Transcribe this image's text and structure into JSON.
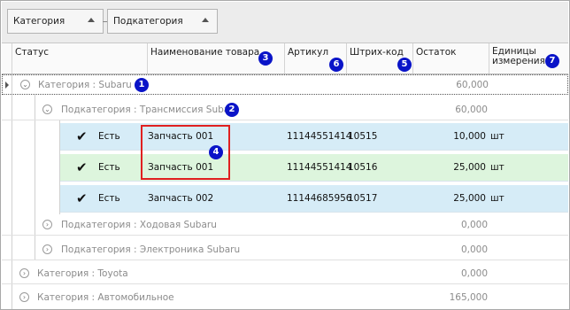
{
  "group_bar": {
    "buttons": [
      {
        "label": "Категория"
      },
      {
        "label": "Подкатегория"
      }
    ]
  },
  "columns": [
    {
      "label": "Статус",
      "badge": ""
    },
    {
      "label": "Наименование товара",
      "badge": "3"
    },
    {
      "label": "Артикул",
      "badge": "6"
    },
    {
      "label": "Штрих-код",
      "badge": "5"
    },
    {
      "label": "Остаток",
      "badge": ""
    },
    {
      "label": "Единицы измерения",
      "badge": "7"
    }
  ],
  "groups": [
    {
      "text": "Категория : Subaru",
      "badge": "1",
      "total": "60,000"
    },
    {
      "text": "Подкатегория : Трансмиссия Subaru",
      "badge": "2",
      "total": "60,000"
    },
    {
      "text": "Подкатегория : Ходовая Subaru",
      "total": "0,000"
    },
    {
      "text": "Подкатегория : Электроника Subaru",
      "total": "0,000"
    },
    {
      "text": "Категория : Toyota",
      "total": "0,000"
    },
    {
      "text": "Категория : Автомобильное",
      "total": "165,000"
    }
  ],
  "rows": [
    {
      "status": "Есть",
      "name": "Запчасть 001",
      "article": "11144551414",
      "barcode": "10515",
      "stock": "10,000",
      "unit": "шт"
    },
    {
      "status": "Есть",
      "name": "Запчасть 001",
      "article": "11144551414",
      "barcode": "10516",
      "stock": "25,000",
      "unit": "шт"
    },
    {
      "status": "Есть",
      "name": "Запчасть 002",
      "article": "11144685956",
      "barcode": "10517",
      "stock": "25,000",
      "unit": "шт"
    }
  ],
  "highlight_badge": "4",
  "colors": {
    "row_blue": "#d6ecf7",
    "row_green": "#ddf5dd",
    "badge": "#0a14c8",
    "highlight_border": "#e02020"
  },
  "icons": {
    "row_indicator": "triangle-right",
    "group_toggle": "collapse-circle",
    "status_check": "check-mark"
  }
}
